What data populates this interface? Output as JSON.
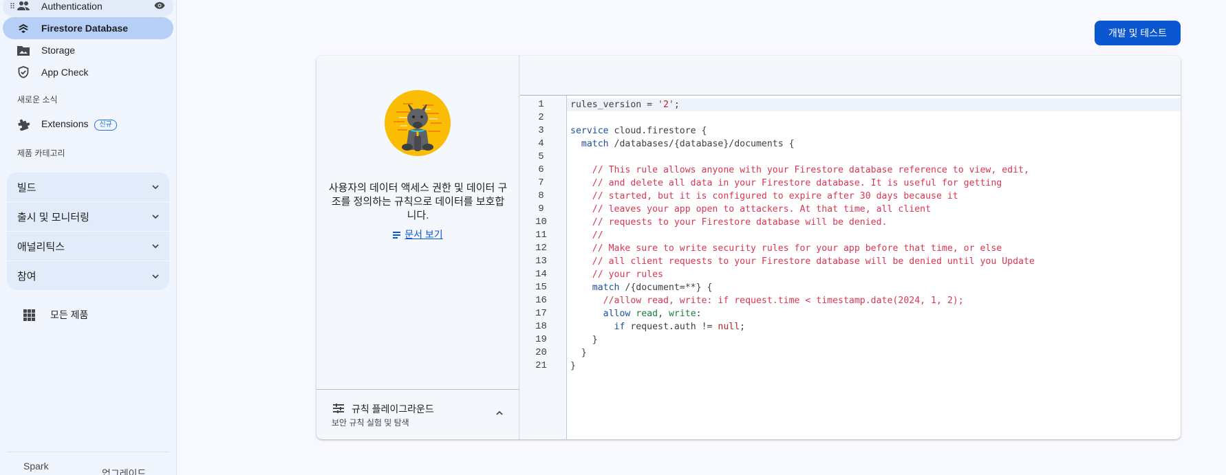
{
  "sidebar": {
    "items": [
      {
        "label": "Authentication",
        "icon": "people-icon"
      },
      {
        "label": "Firestore Database",
        "icon": "firestore-icon"
      },
      {
        "label": "Storage",
        "icon": "image-folder-icon"
      },
      {
        "label": "App Check",
        "icon": "shield-check-icon"
      }
    ],
    "news_label": "새로운 소식",
    "extensions": {
      "label": "Extensions",
      "badge": "신규",
      "icon": "puzzle-icon"
    },
    "category_label": "제품 카테고리",
    "categories": [
      {
        "label": "빌드"
      },
      {
        "label": "출시 및 모니터링"
      },
      {
        "label": "애널리틱스"
      },
      {
        "label": "참여"
      }
    ],
    "all_products": "모든 제품",
    "plan": "Spark",
    "upgrade": "업그레이드"
  },
  "header": {
    "primary_button": "개발 및 테스트"
  },
  "info_panel": {
    "description": "사용자의 데이터 액세스 권한 및 데이터 구조를 정의하는 규칙으로 데이터를 보호합니다.",
    "doc_link": "문서 보기",
    "playground_title": "규칙 플레이그라운드",
    "playground_subtitle": "보안 규칙 실험 및 탐색"
  },
  "editor": {
    "line_numbers": [
      "1",
      "2",
      "3",
      "4",
      "5",
      "6",
      "7",
      "8",
      "9",
      "10",
      "11",
      "12",
      "13",
      "14",
      "15",
      "16",
      "17",
      "18",
      "19",
      "20",
      "21"
    ],
    "lines": [
      "rules_version = '2';",
      "",
      "service cloud.firestore {",
      "  match /databases/{database}/documents {",
      "",
      "    // This rule allows anyone with your Firestore database reference to view, edit,",
      "    // and delete all data in your Firestore database. It is useful for getting",
      "    // started, but it is configured to expire after 30 days because it",
      "    // leaves your app open to attackers. At that time, all client",
      "    // requests to your Firestore database will be denied.",
      "    //",
      "    // Make sure to write security rules for your app before that time, or else",
      "    // all client requests to your Firestore database will be denied until you Update",
      "    // your rules",
      "    match /{document=**} {",
      "      //allow read, write: if request.time < timestamp.date(2024, 1, 2);",
      "      allow read, write:",
      "        if request.auth != null;",
      "    }",
      "  }",
      "}"
    ]
  },
  "colors": {
    "primary": "#0b57d0",
    "active_nav": "#b6cff7",
    "comment": "#d93651",
    "keyword": "#1a4fa0"
  }
}
